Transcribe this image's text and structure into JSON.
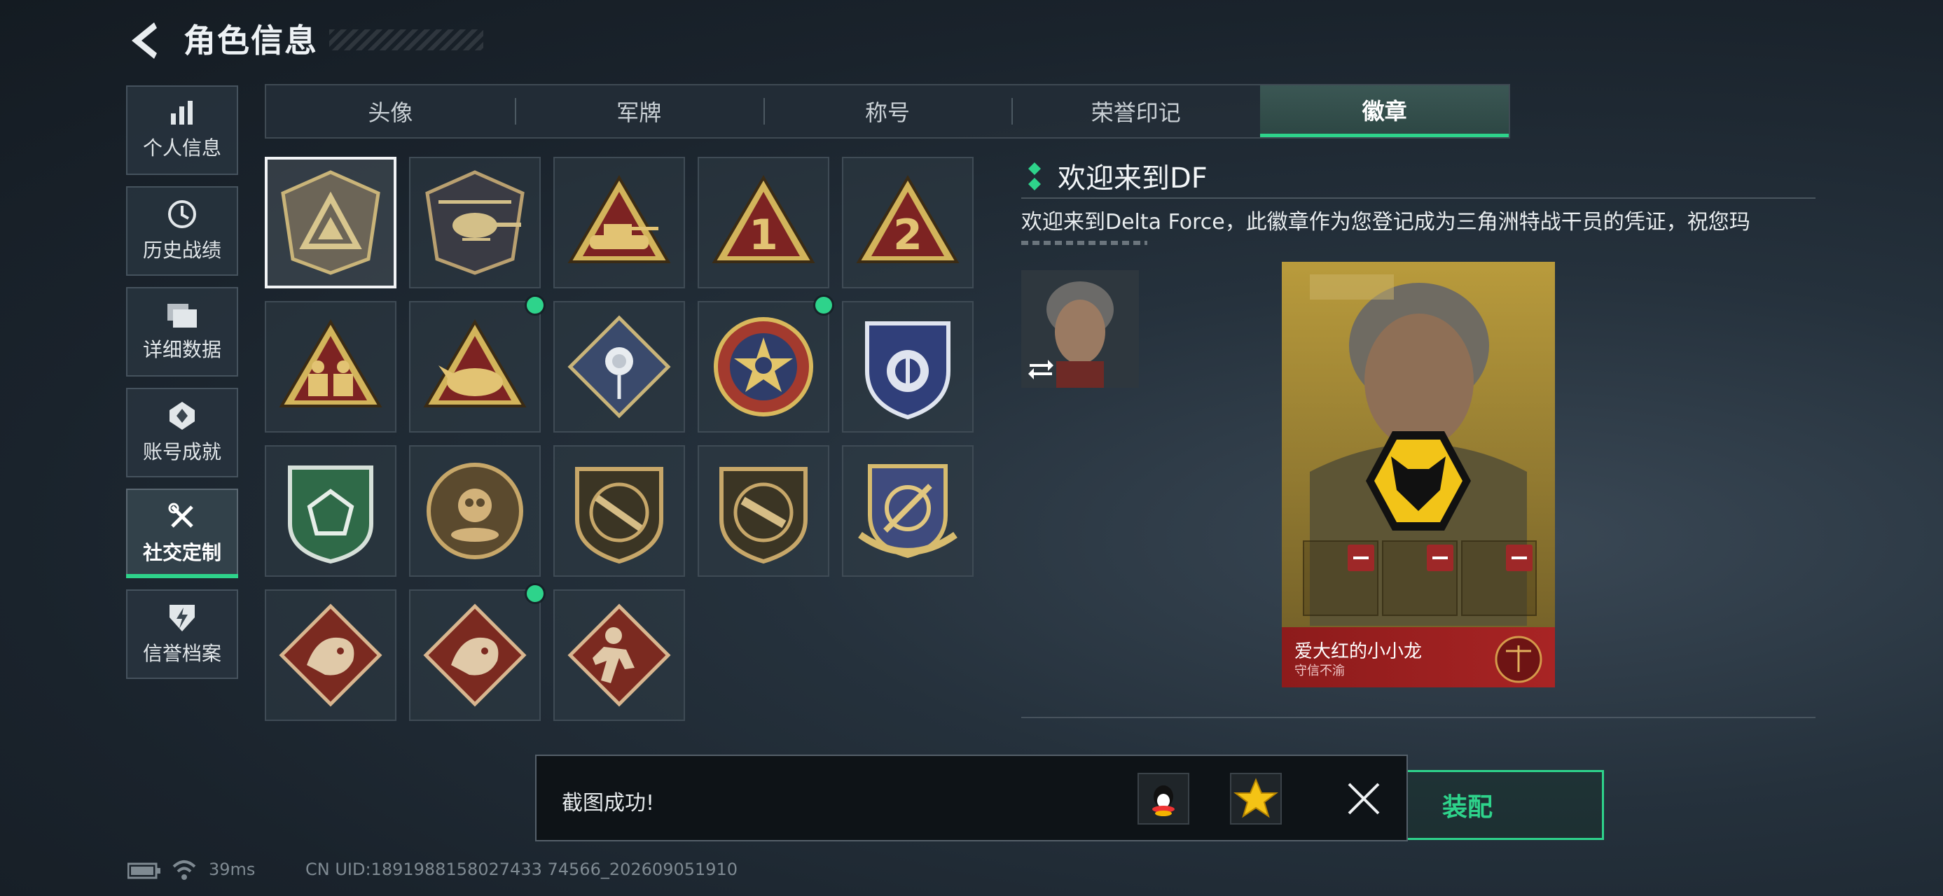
{
  "header": {
    "title": "角色信息"
  },
  "sidebar": {
    "items": [
      {
        "label": "个人信息",
        "icon": "bar-chart-icon"
      },
      {
        "label": "历史战绩",
        "icon": "clock-icon"
      },
      {
        "label": "详细数据",
        "icon": "folder-icon"
      },
      {
        "label": "账号成就",
        "icon": "achievement-icon"
      },
      {
        "label": "社交定制",
        "icon": "tools-icon",
        "active": true
      },
      {
        "label": "信誉档案",
        "icon": "shield-bolt-icon"
      }
    ]
  },
  "tabs": [
    {
      "label": "头像"
    },
    {
      "label": "军牌"
    },
    {
      "label": "称号"
    },
    {
      "label": "荣誉印记"
    },
    {
      "label": "徽章",
      "active": true
    }
  ],
  "badges": [
    {
      "icon": "delta-triangle-badge",
      "selected": true
    },
    {
      "icon": "helicopter-badge"
    },
    {
      "icon": "tank-badge"
    },
    {
      "icon": "number-one-badge"
    },
    {
      "icon": "number-two-badge"
    },
    {
      "icon": "soldiers-badge"
    },
    {
      "icon": "rhino-badge",
      "new": true
    },
    {
      "icon": "rose-badge"
    },
    {
      "icon": "skull-star-badge",
      "new": true
    },
    {
      "icon": "blue-shield-badge"
    },
    {
      "icon": "green-gem-badge"
    },
    {
      "icon": "bronze-crest-badge"
    },
    {
      "icon": "rifle-crest-badge"
    },
    {
      "icon": "smg-crest-badge"
    },
    {
      "icon": "target-shield-badge"
    },
    {
      "icon": "dragon-badge"
    },
    {
      "icon": "dragon-badge-2",
      "new": true
    },
    {
      "icon": "runner-badge"
    }
  ],
  "detail": {
    "title": "欢迎来到DF",
    "description": "欢迎来到Delta Force，此徽章作为您登记成为三角洲特战干员的凭证，祝您玛"
  },
  "card": {
    "name": "爱大红的小小龙",
    "subtitle": "守信不渝",
    "emblem": "wolf-emblem-icon"
  },
  "equip_label": "装配",
  "toast": {
    "message": "截图成功!",
    "share_icons": [
      "qq-icon",
      "star-icon"
    ]
  },
  "status": {
    "ping": "39ms",
    "uid": "CN UID:1891988158027433 74566_202609051910"
  },
  "colors": {
    "accent": "#2ed38b",
    "card_red": "#a82424",
    "card_gold": "#b99b3c"
  }
}
